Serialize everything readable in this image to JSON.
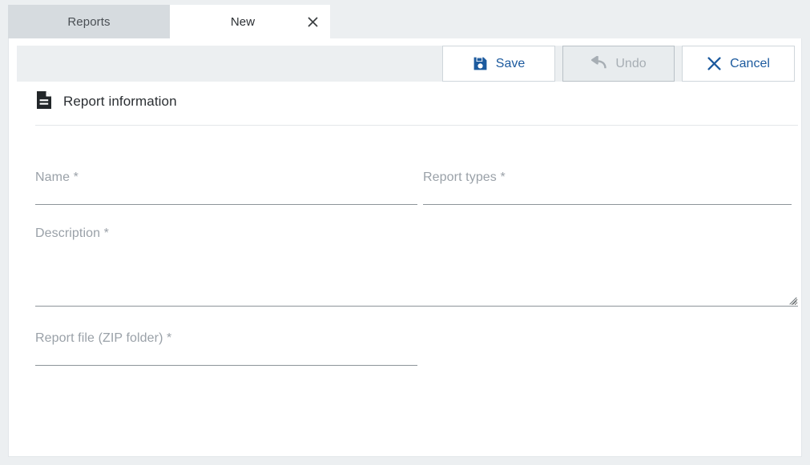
{
  "tabs": [
    {
      "label": "Reports",
      "active": false,
      "closable": false
    },
    {
      "label": "New",
      "active": true,
      "closable": true
    }
  ],
  "toolbar": {
    "save_label": "Save",
    "save_icon": "floppy-disk-icon",
    "undo_label": "Undo",
    "undo_icon": "undo-arrow-icon",
    "undo_disabled": true,
    "cancel_label": "Cancel",
    "cancel_icon": "close-x-icon",
    "accent_color": "#1c5a9e",
    "disabled_color": "#a7aeb4"
  },
  "section": {
    "icon": "document-icon",
    "title": "Report information"
  },
  "form": {
    "fields": [
      {
        "label": "Name *",
        "value": "",
        "placeholder": "",
        "type": "text"
      },
      {
        "label": "Report types *",
        "value": "",
        "placeholder": "",
        "type": "text"
      },
      {
        "label": "Description *",
        "value": "",
        "placeholder": "",
        "type": "textarea"
      },
      {
        "label": "Report file (ZIP folder) *",
        "value": "",
        "placeholder": "",
        "type": "text"
      }
    ]
  },
  "colors": {
    "page_background": "#eceff1",
    "card_background": "#ffffff",
    "tab_inactive": "#d6dbdf",
    "label_gray": "#9aa1a8",
    "underline": "#8d9499"
  }
}
